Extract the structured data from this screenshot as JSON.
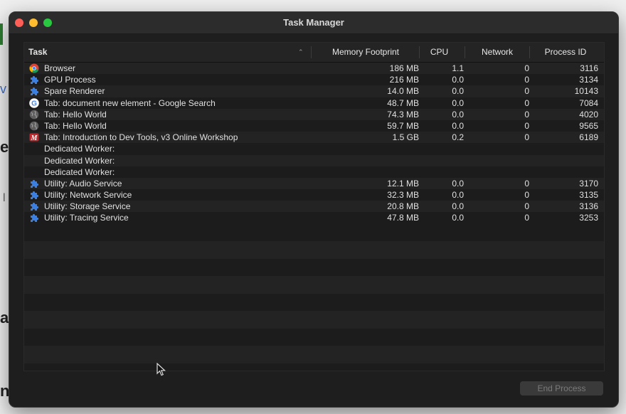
{
  "window": {
    "title": "Task Manager"
  },
  "table": {
    "columns": {
      "task": "Task",
      "memory": "Memory Footprint",
      "cpu": "CPU",
      "network": "Network",
      "pid": "Process ID"
    },
    "rows": [
      {
        "icon": "chrome-icon",
        "task": "Browser",
        "memory": "186 MB",
        "cpu": "1.1",
        "network": "0",
        "pid": "3116"
      },
      {
        "icon": "puzzle-icon",
        "task": "GPU Process",
        "memory": "216 MB",
        "cpu": "0.0",
        "network": "0",
        "pid": "3134"
      },
      {
        "icon": "puzzle-icon",
        "task": "Spare Renderer",
        "memory": "14.0 MB",
        "cpu": "0.0",
        "network": "0",
        "pid": "10143"
      },
      {
        "icon": "google-icon",
        "task": "Tab: document new element - Google Search",
        "memory": "48.7 MB",
        "cpu": "0.0",
        "network": "0",
        "pid": "7084"
      },
      {
        "icon": "globe-icon",
        "task": "Tab: Hello World",
        "memory": "74.3 MB",
        "cpu": "0.0",
        "network": "0",
        "pid": "4020"
      },
      {
        "icon": "globe-icon",
        "task": "Tab: Hello World",
        "memory": "59.7 MB",
        "cpu": "0.0",
        "network": "0",
        "pid": "9565"
      },
      {
        "icon": "fem-icon",
        "task": "Tab: Introduction to Dev Tools, v3 Online Workshop",
        "memory": "1.5 GB",
        "cpu": "0.2",
        "network": "0",
        "pid": "6189"
      },
      {
        "icon": "",
        "task": "Dedicated Worker:",
        "memory": "",
        "cpu": "",
        "network": "",
        "pid": ""
      },
      {
        "icon": "",
        "task": "Dedicated Worker:",
        "memory": "",
        "cpu": "",
        "network": "",
        "pid": ""
      },
      {
        "icon": "",
        "task": "Dedicated Worker:",
        "memory": "",
        "cpu": "",
        "network": "",
        "pid": ""
      },
      {
        "icon": "puzzle-icon",
        "task": "Utility: Audio Service",
        "memory": "12.1 MB",
        "cpu": "0.0",
        "network": "0",
        "pid": "3170"
      },
      {
        "icon": "puzzle-icon",
        "task": "Utility: Network Service",
        "memory": "32.3 MB",
        "cpu": "0.0",
        "network": "0",
        "pid": "3135"
      },
      {
        "icon": "puzzle-icon",
        "task": "Utility: Storage Service",
        "memory": "20.8 MB",
        "cpu": "0.0",
        "network": "0",
        "pid": "3136"
      },
      {
        "icon": "puzzle-icon",
        "task": "Utility: Tracing Service",
        "memory": "47.8 MB",
        "cpu": "0.0",
        "network": "0",
        "pid": "3253"
      }
    ]
  },
  "actions": {
    "end_process": "End Process"
  }
}
